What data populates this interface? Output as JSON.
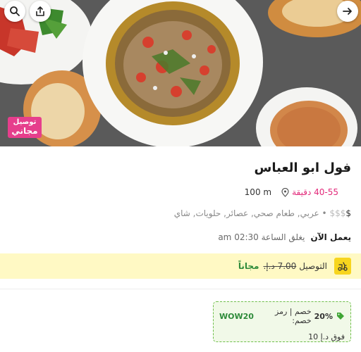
{
  "hero": {
    "image_alt": "فول ابو العباس",
    "badge_line1": "توصيل",
    "badge_line2": "مجاني"
  },
  "actions": {
    "share_icon": "share-icon",
    "search_icon": "search-icon",
    "forward_icon": "arrow-right-icon"
  },
  "restaurant": {
    "name": "فول ابو العباس",
    "delivery_time": "40-55 دقيقة",
    "distance": "100 m",
    "price_active": "$",
    "price_inactive": "$$$",
    "cuisines": "• عربي, طعام صحي, عصائر, حلويات, شاي",
    "open_status": "يعمل الآن",
    "closing_time": "يغلق الساعة 02:30 am"
  },
  "delivery": {
    "label": "التوصيل",
    "old_price": "7.00 د.إ.",
    "new_price": "مجاناً"
  },
  "promo": {
    "discount": "20%",
    "text": "خصم | رمز خصم:",
    "code": "WOW20",
    "min_order": "فوق د.إ 10"
  },
  "colors": {
    "brand_pink": "#e2297a",
    "badge_pink": "#e63e8c",
    "delivery_bg": "#fff9c4",
    "delivery_icon": "#f7d51e",
    "promo_green": "#2e8b3a",
    "promo_bg": "#f1f9e8"
  }
}
